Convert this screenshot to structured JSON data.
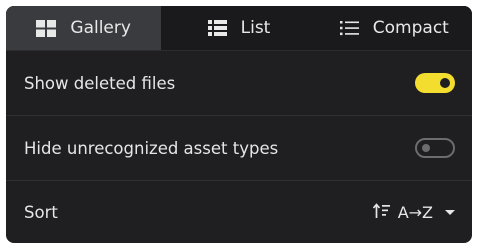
{
  "tabs": [
    {
      "label": "Gallery",
      "icon": "gallery-grid-icon",
      "active": true
    },
    {
      "label": "List",
      "icon": "list-icon",
      "active": false
    },
    {
      "label": "Compact",
      "icon": "compact-list-icon",
      "active": false
    }
  ],
  "settings": {
    "show_deleted": {
      "label": "Show deleted files",
      "enabled": true
    },
    "hide_unrecognized": {
      "label": "Hide unrecognized asset types",
      "enabled": false
    },
    "sort": {
      "label": "Sort",
      "value": "A→Z",
      "icon": "sort-icon"
    }
  },
  "colors": {
    "panel": "#1f1f21",
    "active_tab": "#3a3b3e",
    "toggle_on": "#f3dd2f",
    "toggle_off": "#6c6c70"
  }
}
